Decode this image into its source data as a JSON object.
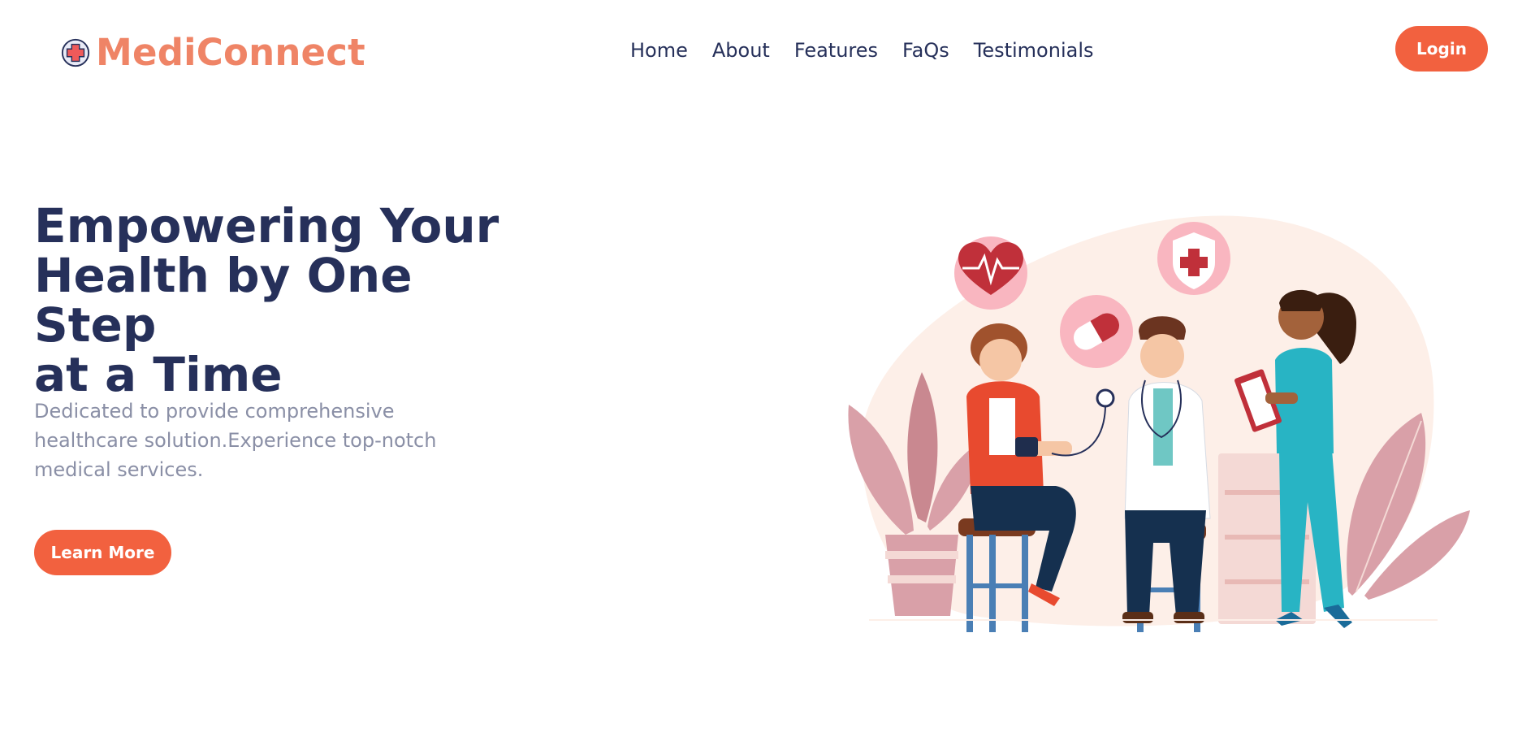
{
  "brand": {
    "name": "MediConnect",
    "icon": "medical-cross-icon",
    "color": "#ef8466"
  },
  "nav": {
    "items": [
      {
        "label": "Home"
      },
      {
        "label": "About"
      },
      {
        "label": "Features"
      },
      {
        "label": "FaQs"
      },
      {
        "label": "Testimonials"
      }
    ],
    "login_label": "Login"
  },
  "hero": {
    "title_lines": [
      "Empowering Your",
      "Health by One Step",
      "at a Time"
    ],
    "subtitle": "Dedicated to provide comprehensive healthcare solution.Experience top-notch medical services.",
    "cta_label": "Learn More"
  },
  "colors": {
    "accent": "#f2613f",
    "heading": "#26305a",
    "muted": "#8a8fa6",
    "blob": "#fdefe8"
  },
  "illustration": {
    "icons": [
      "heart-rate-icon",
      "pill-icon",
      "shield-cross-icon"
    ]
  }
}
